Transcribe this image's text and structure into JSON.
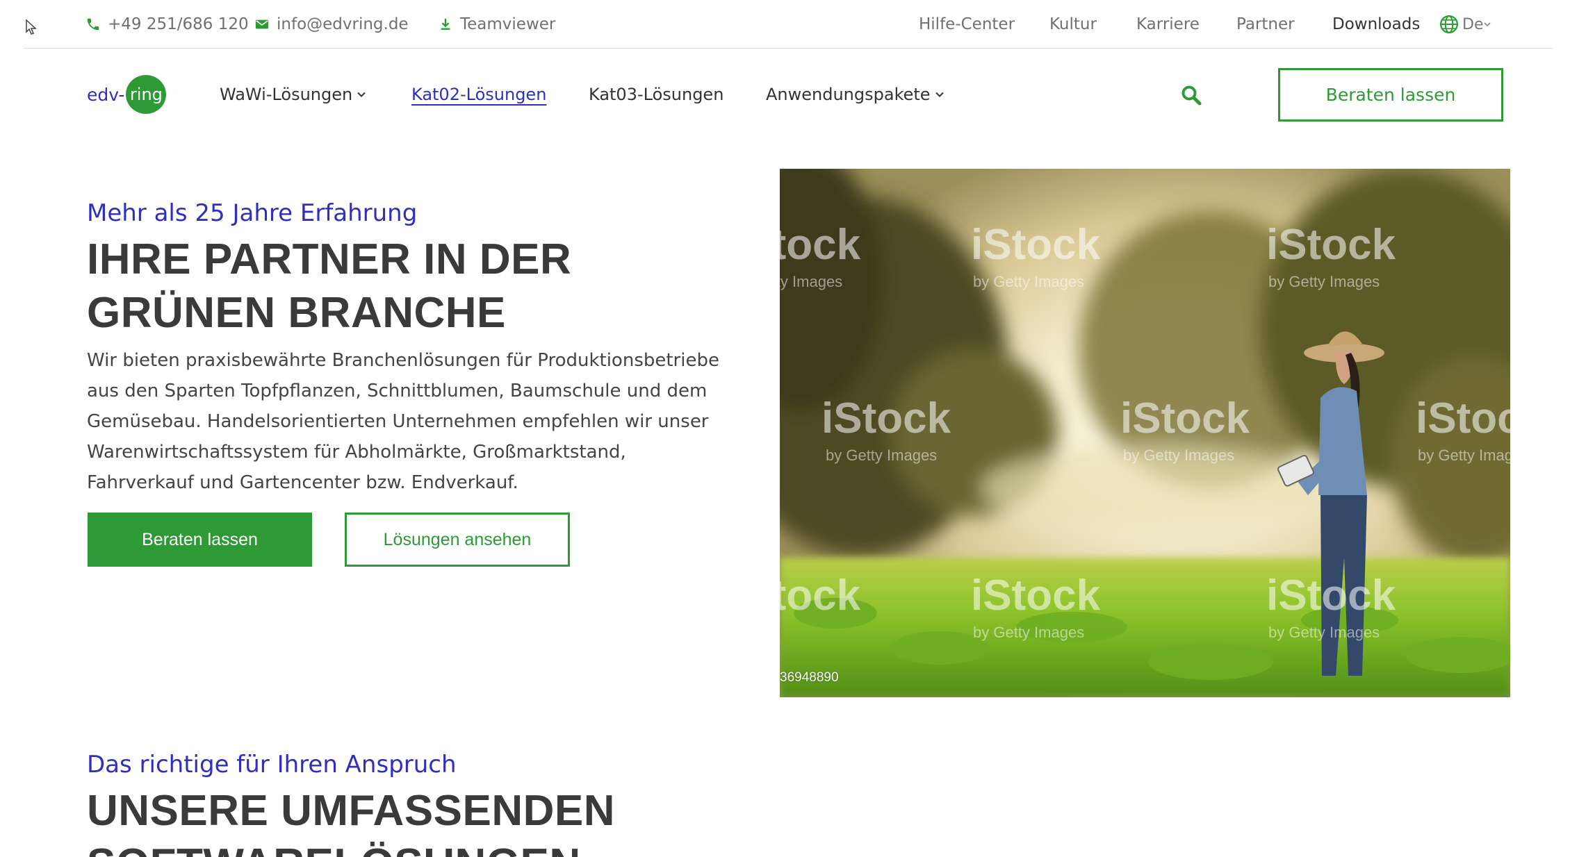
{
  "topbar": {
    "phone": "+49 251/686 120",
    "email": "info@edvring.de",
    "teamviewer": "Teamviewer",
    "links": [
      "Hilfe-Center",
      "Kultur",
      "Karriere",
      "Partner",
      "Downloads"
    ],
    "language": "De"
  },
  "logo": {
    "prefix": "edv-",
    "badge": "ring"
  },
  "nav": {
    "items": [
      "WaWi-Lösungen",
      "Kat02-Lösungen",
      "Kat03-Lösungen",
      "Anwendungspakete"
    ],
    "cta": "Beraten lassen"
  },
  "hero": {
    "eyebrow": "Mehr als 25 Jahre Erfahrung",
    "title_line1": "IHRE PARTNER IN DER",
    "title_line2": "GRÜNEN BRANCHE",
    "body": "Wir bieten praxisbewährte Branchenlösungen für Produktionsbetriebe aus den Sparten Topfpflanzen, Schnittblumen, Baumschule und dem Gemüsebau. Handelsorientierten Unternehmen empfehlen wir unser Warenwirtschaftssystem für Abholmärkte, Großmarktstand, Fahrverkauf und Gartencenter bzw. Endverkauf.",
    "primary_button": "Beraten lassen",
    "secondary_button": "Lösungen ansehen",
    "image_stock_id": "36948890",
    "watermark": "iStock",
    "watermark_sub": "by Getty Images"
  },
  "section2": {
    "eyebrow": "Das richtige für Ihren Anspruch",
    "title_line1": "UNSERE UMFASSENDEN",
    "title_line2": "SOFTWARELÖSUNGEN"
  },
  "colors": {
    "brand_green": "#2e9a36",
    "brand_blue": "#2f2fbf"
  }
}
